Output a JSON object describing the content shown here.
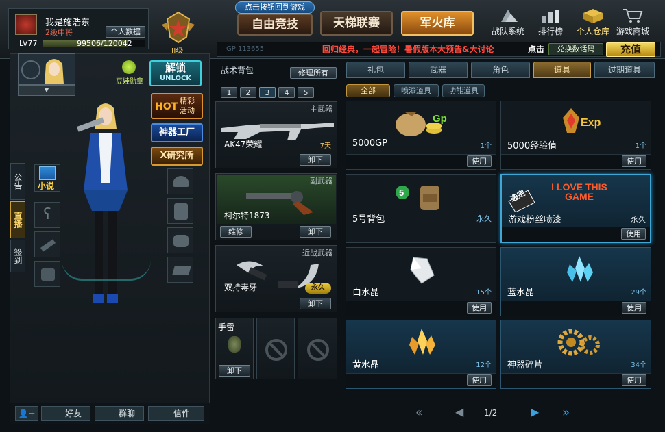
{
  "player": {
    "name": "我是施浩东",
    "rank": "2级中将",
    "level": "LV77",
    "xp": "99506/120042",
    "profile_btn": "个人数据",
    "badge_level": "II级"
  },
  "top_nav": {
    "hint": "点击按钮回到游戏",
    "tabs": [
      "自由竞技",
      "天梯联赛",
      "军火库"
    ],
    "icons": [
      "战队系统",
      "排行榜",
      "个人仓库",
      "游戏商城"
    ]
  },
  "ticker": {
    "gp_label": "GP 113655",
    "news": "回归经典，一起冒险！暑假版本大预告&大讨论",
    "click": "点击",
    "code_btn": "兑换数话码",
    "charge_btn": "充值"
  },
  "left": {
    "doll_label": "豆娃勋章",
    "unlock": {
      "cn": "解锁",
      "en": "UNLOCK"
    },
    "hot": {
      "cn": "HOT",
      "sub": "精彩活动"
    },
    "shenqi": "神器工厂",
    "xlab": "X研究所",
    "novel": "小说",
    "side_tabs": [
      "公告",
      "直播",
      "签到"
    ],
    "bottom": [
      "好友",
      "群聊",
      "信件"
    ]
  },
  "backpack": {
    "title": "战术背包",
    "repair_btn": "修理所有",
    "pages": [
      "1",
      "2",
      "3",
      "4",
      "5"
    ],
    "primary": {
      "slot": "主武器",
      "name": "AK47荣耀",
      "duration": "7天",
      "btn": "卸下"
    },
    "secondary": {
      "slot": "副武器",
      "name": "柯尔特1873",
      "btn_repair": "维修",
      "btn": "卸下"
    },
    "melee": {
      "slot": "近战武器",
      "name": "双持毒牙",
      "badge": "永久",
      "btn": "卸下"
    },
    "grenade": {
      "slot": "手雷",
      "btn": "卸下"
    }
  },
  "tabs": [
    "礼包",
    "武器",
    "角色",
    "道具",
    "过期道具"
  ],
  "subtabs": [
    "全部",
    "喷漆道具",
    "功能道具"
  ],
  "items": [
    {
      "name": "5000GP",
      "count": "1个",
      "use": "使用",
      "icon": "money-bag-icon"
    },
    {
      "name": "5000经验值",
      "count": "1个",
      "use": "使用",
      "icon": "exp-icon"
    },
    {
      "name": "5号背包",
      "count": "永久",
      "use": "",
      "icon": "backpack-icon"
    },
    {
      "name": "游戏粉丝喷漆",
      "count": "永久",
      "use": "使用",
      "icon": "spray-icon",
      "spray_text": "I LOVE THIS GAME",
      "tag": "选定"
    },
    {
      "name": "白水晶",
      "count": "15个",
      "use": "使用",
      "icon": "white-crystal-icon"
    },
    {
      "name": "蓝水晶",
      "count": "29个",
      "use": "使用",
      "icon": "blue-crystal-icon"
    },
    {
      "name": "黄水晶",
      "count": "12个",
      "use": "使用",
      "icon": "yellow-crystal-icon"
    },
    {
      "name": "神器碎片",
      "count": "34个",
      "use": "使用",
      "icon": "gear-icon"
    }
  ],
  "pagination": {
    "label": "1/2"
  },
  "colors": {
    "accent_gold": "#c99b45",
    "accent_blue": "#3fa7d6",
    "news_red": "#ff4a3d"
  }
}
